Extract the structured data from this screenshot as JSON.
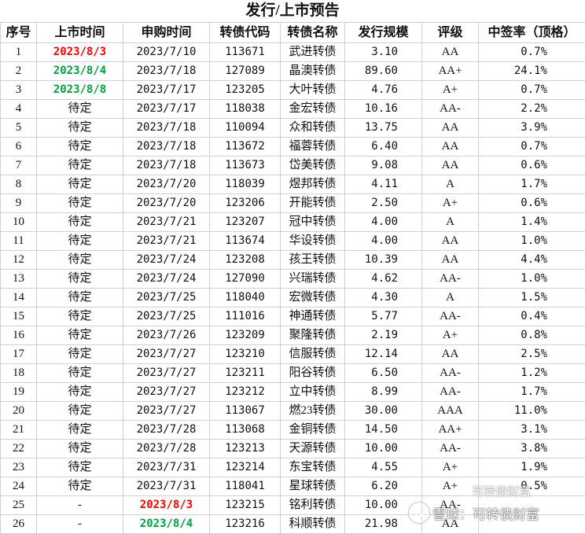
{
  "title": "发行/上市预告",
  "headers": [
    "序号",
    "上市时间",
    "申购时间",
    "转债代码",
    "转债名称",
    "发行规模",
    "评级",
    "中签率（顶格）"
  ],
  "rows": [
    {
      "no": "1",
      "list": "2023/8/3",
      "list_color": "red",
      "sub": "2023/7/10",
      "sub_color": "",
      "code": "113671",
      "name": "武进转债",
      "scale": "3.10",
      "rating": "AA",
      "rate": "0.7%"
    },
    {
      "no": "2",
      "list": "2023/8/4",
      "list_color": "green",
      "sub": "2023/7/18",
      "sub_color": "",
      "code": "127089",
      "name": "晶澳转债",
      "scale": "89.60",
      "rating": "AA+",
      "rate": "24.1%"
    },
    {
      "no": "3",
      "list": "2023/8/8",
      "list_color": "green",
      "sub": "2023/7/17",
      "sub_color": "",
      "code": "123205",
      "name": "大叶转债",
      "scale": "4.76",
      "rating": "A+",
      "rate": "0.7%"
    },
    {
      "no": "4",
      "list": "待定",
      "list_color": "",
      "sub": "2023/7/17",
      "sub_color": "",
      "code": "118038",
      "name": "金宏转债",
      "scale": "10.16",
      "rating": "AA-",
      "rate": "2.2%"
    },
    {
      "no": "5",
      "list": "待定",
      "list_color": "",
      "sub": "2023/7/18",
      "sub_color": "",
      "code": "110094",
      "name": "众和转债",
      "scale": "13.75",
      "rating": "AA",
      "rate": "3.9%"
    },
    {
      "no": "6",
      "list": "待定",
      "list_color": "",
      "sub": "2023/7/18",
      "sub_color": "",
      "code": "113672",
      "name": "福蓉转债",
      "scale": "6.40",
      "rating": "AA",
      "rate": "0.7%"
    },
    {
      "no": "7",
      "list": "待定",
      "list_color": "",
      "sub": "2023/7/18",
      "sub_color": "",
      "code": "113673",
      "name": "岱美转债",
      "scale": "9.08",
      "rating": "AA",
      "rate": "0.6%"
    },
    {
      "no": "8",
      "list": "待定",
      "list_color": "",
      "sub": "2023/7/20",
      "sub_color": "",
      "code": "118039",
      "name": "煜邦转债",
      "scale": "4.11",
      "rating": "A",
      "rate": "1.7%"
    },
    {
      "no": "9",
      "list": "待定",
      "list_color": "",
      "sub": "2023/7/20",
      "sub_color": "",
      "code": "123206",
      "name": "开能转债",
      "scale": "2.50",
      "rating": "A+",
      "rate": "0.6%"
    },
    {
      "no": "10",
      "list": "待定",
      "list_color": "",
      "sub": "2023/7/21",
      "sub_color": "",
      "code": "123207",
      "name": "冠中转债",
      "scale": "4.00",
      "rating": "A",
      "rate": "1.4%"
    },
    {
      "no": "11",
      "list": "待定",
      "list_color": "",
      "sub": "2023/7/21",
      "sub_color": "",
      "code": "113674",
      "name": "华设转债",
      "scale": "4.00",
      "rating": "AA",
      "rate": "1.0%"
    },
    {
      "no": "12",
      "list": "待定",
      "list_color": "",
      "sub": "2023/7/24",
      "sub_color": "",
      "code": "123208",
      "name": "孩王转债",
      "scale": "10.39",
      "rating": "AA",
      "rate": "4.4%"
    },
    {
      "no": "13",
      "list": "待定",
      "list_color": "",
      "sub": "2023/7/24",
      "sub_color": "",
      "code": "127090",
      "name": "兴瑞转债",
      "scale": "4.62",
      "rating": "AA-",
      "rate": "1.0%"
    },
    {
      "no": "14",
      "list": "待定",
      "list_color": "",
      "sub": "2023/7/25",
      "sub_color": "",
      "code": "118040",
      "name": "宏微转债",
      "scale": "4.30",
      "rating": "A",
      "rate": "1.5%"
    },
    {
      "no": "15",
      "list": "待定",
      "list_color": "",
      "sub": "2023/7/25",
      "sub_color": "",
      "code": "111016",
      "name": "神通转债",
      "scale": "5.77",
      "rating": "AA-",
      "rate": "0.4%"
    },
    {
      "no": "16",
      "list": "待定",
      "list_color": "",
      "sub": "2023/7/26",
      "sub_color": "",
      "code": "123209",
      "name": "聚隆转债",
      "scale": "2.19",
      "rating": "A+",
      "rate": "0.8%"
    },
    {
      "no": "17",
      "list": "待定",
      "list_color": "",
      "sub": "2023/7/27",
      "sub_color": "",
      "code": "123210",
      "name": "信服转债",
      "scale": "12.14",
      "rating": "AA",
      "rate": "2.5%"
    },
    {
      "no": "18",
      "list": "待定",
      "list_color": "",
      "sub": "2023/7/27",
      "sub_color": "",
      "code": "123211",
      "name": "阳谷转债",
      "scale": "6.50",
      "rating": "AA-",
      "rate": "1.2%"
    },
    {
      "no": "19",
      "list": "待定",
      "list_color": "",
      "sub": "2023/7/27",
      "sub_color": "",
      "code": "123212",
      "name": "立中转债",
      "scale": "8.99",
      "rating": "AA-",
      "rate": "1.7%"
    },
    {
      "no": "20",
      "list": "待定",
      "list_color": "",
      "sub": "2023/7/27",
      "sub_color": "",
      "code": "113067",
      "name": "燃23转债",
      "scale": "30.00",
      "rating": "AAA",
      "rate": "11.0%"
    },
    {
      "no": "21",
      "list": "待定",
      "list_color": "",
      "sub": "2023/7/28",
      "sub_color": "",
      "code": "113068",
      "name": "金铜转债",
      "scale": "14.50",
      "rating": "AA+",
      "rate": "3.1%"
    },
    {
      "no": "22",
      "list": "待定",
      "list_color": "",
      "sub": "2023/7/28",
      "sub_color": "",
      "code": "123213",
      "name": "天源转债",
      "scale": "10.00",
      "rating": "AA-",
      "rate": "3.8%"
    },
    {
      "no": "23",
      "list": "待定",
      "list_color": "",
      "sub": "2023/7/31",
      "sub_color": "",
      "code": "123214",
      "name": "东宝转债",
      "scale": "4.55",
      "rating": "A+",
      "rate": "1.9%"
    },
    {
      "no": "24",
      "list": "待定",
      "list_color": "",
      "sub": "2023/7/31",
      "sub_color": "",
      "code": "118041",
      "name": "星球转债",
      "scale": "6.20",
      "rating": "A+",
      "rate": "0.5%"
    },
    {
      "no": "25",
      "list": "-",
      "list_color": "",
      "sub": "2023/8/3",
      "sub_color": "red",
      "code": "123215",
      "name": "铭利转债",
      "scale": "10.00",
      "rating": "AA-",
      "rate": ""
    },
    {
      "no": "26",
      "list": "-",
      "list_color": "",
      "sub": "2023/8/4",
      "sub_color": "green",
      "code": "123216",
      "name": "科顺转债",
      "scale": "21.98",
      "rating": "AA",
      "rate": ""
    }
  ],
  "watermark": {
    "text": "雪球：可转债财富",
    "line2": "可转债财富",
    "icon": "snowball-icon"
  },
  "colors": {
    "red": "#ff0000",
    "green": "#00a040",
    "grid": "#cfcfcf"
  }
}
